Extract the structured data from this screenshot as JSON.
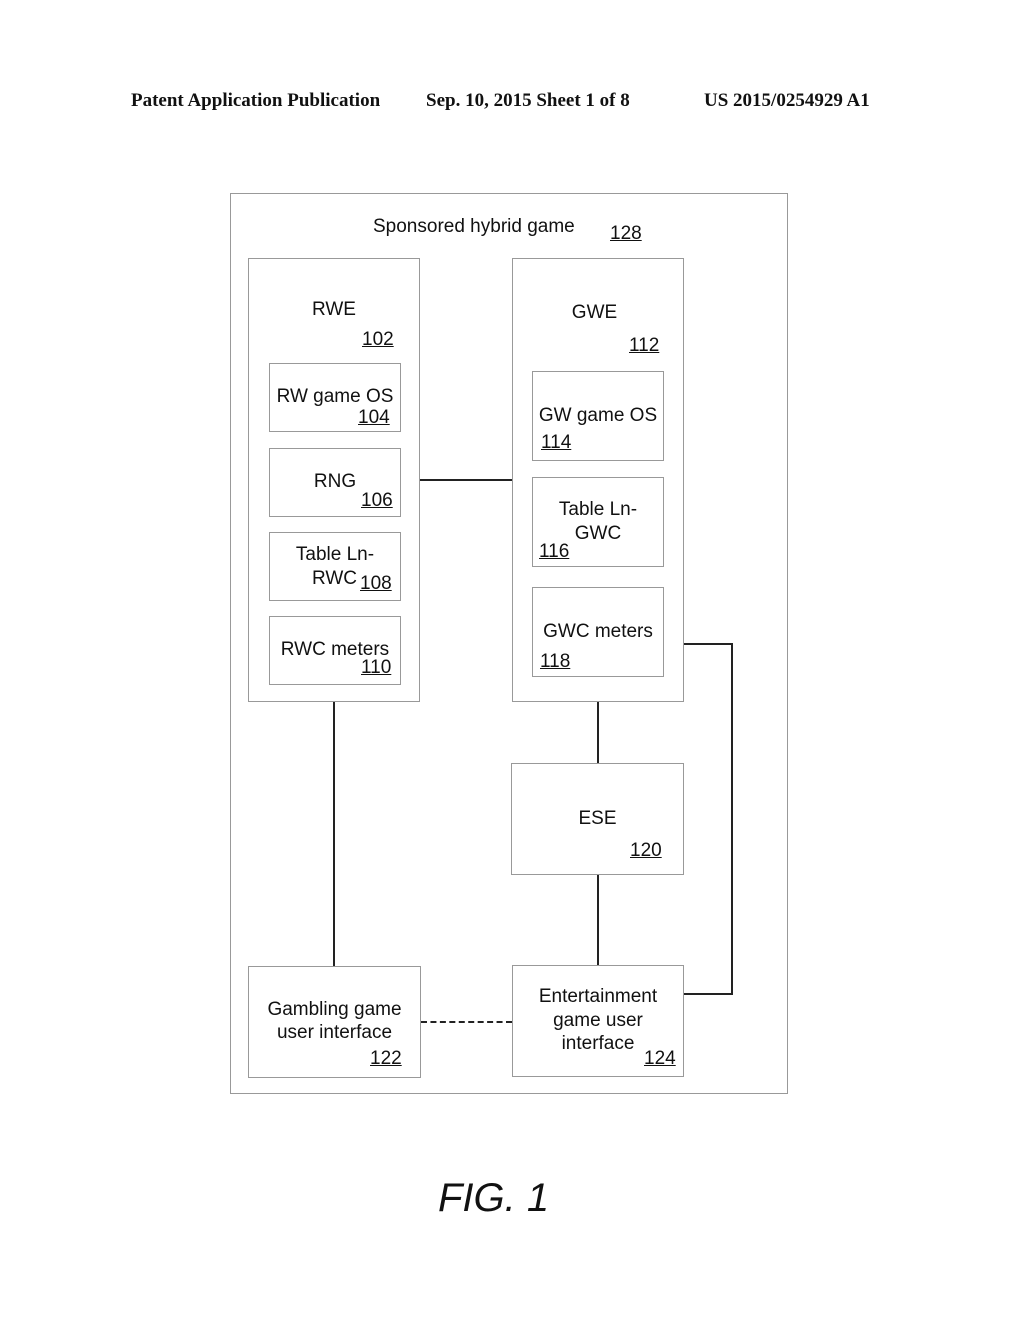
{
  "header": {
    "left": "Patent Application Publication",
    "date_sheet": "Sep. 10, 2015   Sheet 1 of 8",
    "number": "US 2015/0254929 A1"
  },
  "diagram": {
    "outer": {
      "label": "Sponsored hybrid game",
      "ref": "128"
    },
    "rwe": {
      "label": "RWE",
      "ref": "102",
      "children": [
        {
          "label": "RW game OS",
          "ref": "104"
        },
        {
          "label": "RNG",
          "ref": "106"
        },
        {
          "label_line1": "Table Ln-",
          "label_line2": "RWC",
          "ref": "108"
        },
        {
          "label": "RWC meters",
          "ref": "110"
        }
      ]
    },
    "gwe": {
      "label": "GWE",
      "ref": "112",
      "children": [
        {
          "label": "GW game OS",
          "ref": "114"
        },
        {
          "label_line1": "Table Ln-",
          "label_line2": "GWC",
          "ref": "116"
        },
        {
          "label": "GWC meters",
          "ref": "118"
        }
      ]
    },
    "ese": {
      "label": "ESE",
      "ref": "120"
    },
    "gambling_ui": {
      "label_line1": "Gambling game",
      "label_line2": "user interface",
      "ref": "122"
    },
    "entertainment_ui": {
      "label_line1": "Entertainment",
      "label_line2": "game user",
      "label_line3": "interface",
      "ref": "124"
    },
    "connections": [
      {
        "from": "RWE",
        "to": "GWE",
        "style": "solid"
      },
      {
        "from": "RWE",
        "to": "Gambling game user interface",
        "style": "solid"
      },
      {
        "from": "GWE",
        "to": "ESE",
        "style": "solid"
      },
      {
        "from": "ESE",
        "to": "Entertainment game user interface",
        "style": "solid"
      },
      {
        "from": "GWC meters",
        "to": "Entertainment game user interface",
        "style": "solid"
      },
      {
        "from": "Gambling game user interface",
        "to": "Entertainment game user interface",
        "style": "dashed"
      }
    ]
  },
  "figure_label": "FIG. 1"
}
